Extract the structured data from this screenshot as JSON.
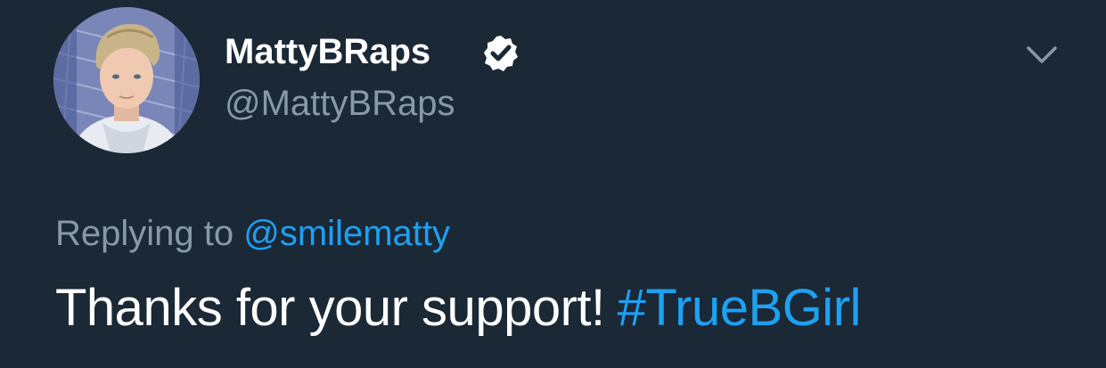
{
  "author": {
    "display_name": "MattyBRaps",
    "handle": "@MattyBRaps",
    "verified": true
  },
  "reply": {
    "prefix": "Replying to",
    "mention": "@smilematty"
  },
  "tweet": {
    "text": "Thanks for your support!",
    "hashtag": "#TrueBGirl"
  },
  "icons": {
    "avatar": "profile-photo",
    "verified": "verified-badge-icon",
    "menu": "chevron-down-icon"
  },
  "colors": {
    "background": "#1b2836",
    "primary_text": "#ffffff",
    "secondary_text": "#8899a6",
    "link": "#1da1f2"
  }
}
